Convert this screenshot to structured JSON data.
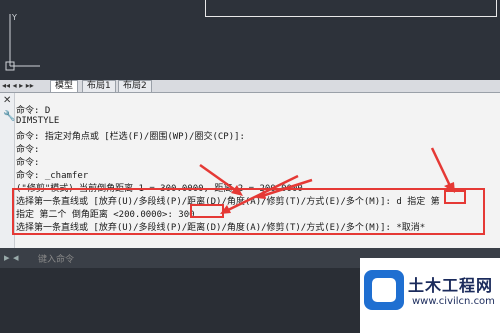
{
  "tabs": {
    "nav_arrows": "◂◂ ◂ ▸ ▸▸",
    "model": "模型",
    "layout1": "布局1",
    "layout2": "布局2"
  },
  "command_history": [
    "命令: D",
    "DIMSTYLE",
    "命令: 指定对角点或 [栏选(F)/圈围(WP)/圈交(CP)]:",
    "命令:",
    "命令:",
    "命令: _chamfer",
    "(\"修剪\"模式) 当前倒角距离 1 = 300.0000, 距离 2 = 200.0000",
    "选择第一条直线或 [放弃(U)/多段线(P)/距离(D)/角度(A)/修剪(T)/方式(E)/多个(M)]: d 指定 第",
    "指定 第二个 倒角距离 <200.0000>: 300",
    "选择第一条直线或 [放弃(U)/多段线(P)/距离(D)/角度(A)/修剪(T)/方式(E)/多个(M)]: *取消*"
  ],
  "input": {
    "placeholder": "键入命令"
  },
  "watermark": {
    "title": "土木工程网",
    "url": "www.civilcn.com"
  },
  "colors": {
    "highlight": "#e53935",
    "drawing_bg": "#2d323a",
    "command_bg": "#f3f3f3"
  }
}
